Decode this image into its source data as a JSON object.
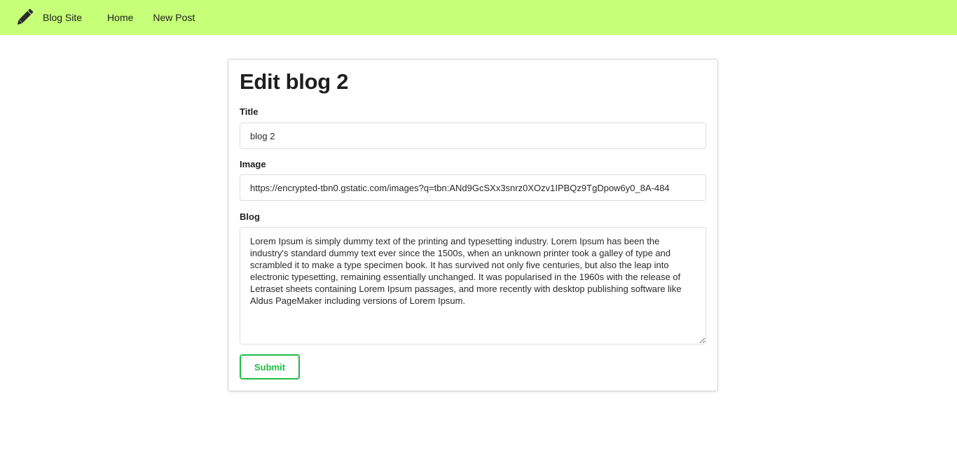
{
  "navbar": {
    "brand_icon": "pencil-icon",
    "brand_label": "Blog Site",
    "items": [
      {
        "label": "Home"
      },
      {
        "label": "New Post"
      }
    ],
    "background_color": "#c6ff78"
  },
  "form": {
    "heading": "Edit blog 2",
    "title_label": "Title",
    "title_value": "blog 2",
    "image_label": "Image",
    "image_value": "https://encrypted-tbn0.gstatic.com/images?q=tbn:ANd9GcSXx3snrz0XOzv1IPBQz9TgDpow6y0_8A-484",
    "blog_label": "Blog",
    "blog_value": "Lorem Ipsum is simply dummy text of the printing and typesetting industry. Lorem Ipsum has been the industry's standard dummy text ever since the 1500s, when an unknown printer took a galley of type and scrambled it to make a type specimen book. It has survived not only five centuries, but also the leap into electronic typesetting, remaining essentially unchanged. It was popularised in the 1960s with the release of Letraset sheets containing Lorem Ipsum passages, and more recently with desktop publishing software like Aldus PageMaker including versions of Lorem Ipsum.",
    "submit_label": "Submit",
    "submit_color": "#21ba45"
  }
}
